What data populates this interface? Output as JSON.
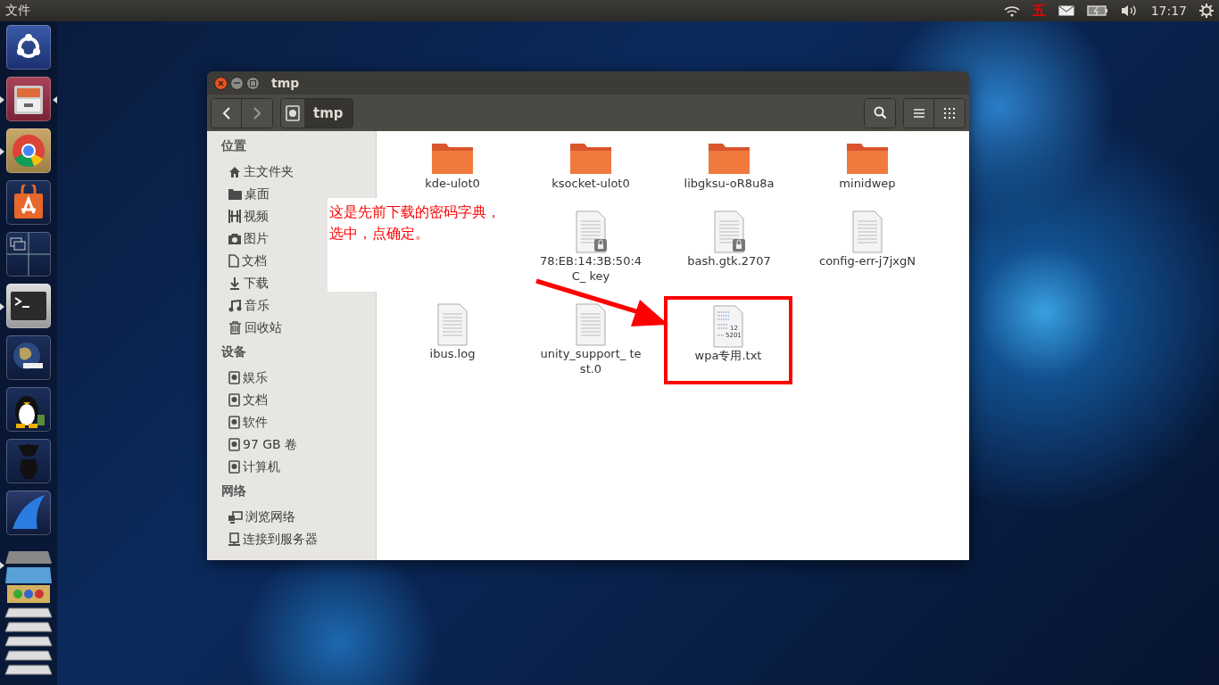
{
  "top_bar": {
    "app_menu": "文件",
    "input_method": "五",
    "clock": "17:17"
  },
  "launcher": [
    {
      "kind": "dash",
      "running": false,
      "focused": false
    },
    {
      "kind": "files",
      "running": true,
      "focused": true
    },
    {
      "kind": "browser",
      "running": true,
      "focused": false
    },
    {
      "kind": "store",
      "running": false,
      "focused": false
    },
    {
      "kind": "workspaces",
      "running": false,
      "focused": false
    },
    {
      "kind": "terminal",
      "running": true,
      "focused": false
    },
    {
      "kind": "globe",
      "running": false,
      "focused": false
    },
    {
      "kind": "penguin",
      "running": false,
      "focused": false
    },
    {
      "kind": "figure",
      "running": false,
      "focused": false
    },
    {
      "kind": "fin",
      "running": false,
      "focused": false
    },
    {
      "kind": "stack",
      "running": true,
      "focused": false
    }
  ],
  "window": {
    "title": "tmp",
    "path": [
      {
        "label": "tmp",
        "selected": true
      }
    ]
  },
  "sidebar": [
    {
      "heading": "位置",
      "items": [
        {
          "kind": "home",
          "label": "主文件夹"
        },
        {
          "kind": "folder",
          "label": "桌面"
        },
        {
          "kind": "film",
          "label": "视频"
        },
        {
          "kind": "camera",
          "label": "图片"
        },
        {
          "kind": "document",
          "label": "文档"
        },
        {
          "kind": "download",
          "label": "下载"
        },
        {
          "kind": "music",
          "label": "音乐"
        },
        {
          "kind": "trash",
          "label": "回收站"
        }
      ]
    },
    {
      "heading": "设备",
      "items": [
        {
          "kind": "drive",
          "label": "娱乐"
        },
        {
          "kind": "drive",
          "label": "文档"
        },
        {
          "kind": "drive",
          "label": "软件"
        },
        {
          "kind": "drive",
          "label": "97 GB 卷"
        },
        {
          "kind": "drive",
          "label": "计算机"
        }
      ]
    },
    {
      "heading": "网络",
      "items": [
        {
          "kind": "network",
          "label": "浏览网络"
        },
        {
          "kind": "server",
          "label": "连接到服务器"
        }
      ]
    }
  ],
  "files": [
    [
      {
        "kind": "folder",
        "name": "kde-ulot0",
        "highlighted": false
      },
      {
        "kind": "folder",
        "name": "ksocket-ulot0",
        "highlighted": false
      },
      {
        "kind": "folder",
        "name": "libgksu-oR8u8a",
        "highlighted": false
      },
      {
        "kind": "folder",
        "name": "minidwep",
        "highlighted": false
      }
    ],
    [
      {
        "kind": "locked",
        "name": "78:EB:14:3B:50:4C_ key",
        "highlighted": false
      },
      {
        "kind": "locked",
        "name": "bash.gtk.2707",
        "highlighted": false
      },
      {
        "kind": "text",
        "name": "config-err-j7jxgN",
        "highlighted": false
      }
    ],
    [
      {
        "kind": "text",
        "name": "ibus.log",
        "highlighted": false
      },
      {
        "kind": "text",
        "name": "unity_support_ test.0",
        "highlighted": false
      },
      {
        "kind": "wordlist",
        "name": "wpa专用.txt",
        "preview": [
          "12",
          "5201"
        ],
        "highlighted": true
      }
    ]
  ],
  "annotation": {
    "lines": [
      "这是先前下载的密码字典，",
      "选中，点确定。"
    ]
  }
}
